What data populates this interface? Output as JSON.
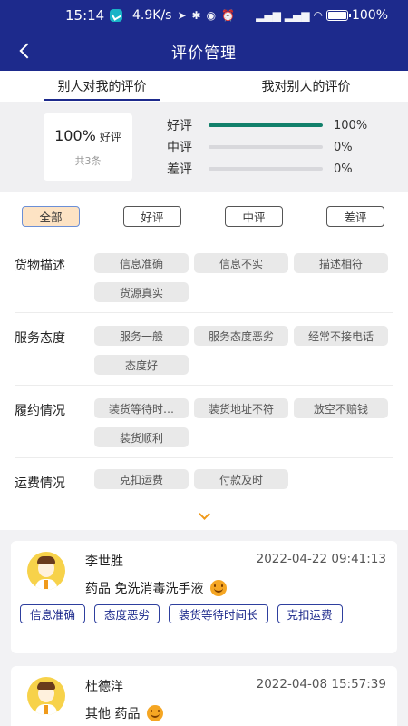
{
  "status_bar": {
    "time": "15:14",
    "network_speed": "4.9K/s",
    "battery": "100%"
  },
  "nav": {
    "title": "评价管理"
  },
  "tabs": [
    {
      "label": "别人对我的评价",
      "active": true
    },
    {
      "label": "我对别人的评价",
      "active": false
    }
  ],
  "summary": {
    "percent": "100%",
    "percent_label": "好评",
    "total": "共3条",
    "bars": [
      {
        "label": "好评",
        "pct_text": "100%",
        "fraction": 1.0
      },
      {
        "label": "中评",
        "pct_text": "0%",
        "fraction": 0.0
      },
      {
        "label": "差评",
        "pct_text": "0%",
        "fraction": 0.0
      }
    ],
    "bar_color": "#12806b"
  },
  "filters": {
    "tabs": [
      {
        "label": "全部",
        "active": true
      },
      {
        "label": "好评",
        "active": false
      },
      {
        "label": "中评",
        "active": false
      },
      {
        "label": "差评",
        "active": false
      }
    ],
    "categories": [
      {
        "label": "货物描述",
        "chips": [
          "信息准确",
          "信息不实",
          "描述相符",
          "货源真实"
        ]
      },
      {
        "label": "服务态度",
        "chips": [
          "服务一般",
          "服务态度恶劣",
          "经常不接电话",
          "态度好"
        ]
      },
      {
        "label": "履约情况",
        "chips": [
          "装货等待时…",
          "装货地址不符",
          "放空不赔钱",
          "装货顺利"
        ]
      },
      {
        "label": "运费情况",
        "chips": [
          "克扣运费",
          "付款及时"
        ]
      }
    ]
  },
  "reviews": [
    {
      "name": "李世胜",
      "time": "2022-04-22 09:41:13",
      "item": "药品  免洗消毒洗手液",
      "tags": [
        "信息准确",
        "态度恶劣",
        "装货等待时间长",
        "克扣运费"
      ]
    },
    {
      "name": "杜德洋",
      "time": "2022-04-08 15:57:39",
      "item": "其他  药品",
      "tags": []
    }
  ],
  "colors": {
    "primary": "#1d2a8c",
    "accent": "#f09a1a"
  }
}
